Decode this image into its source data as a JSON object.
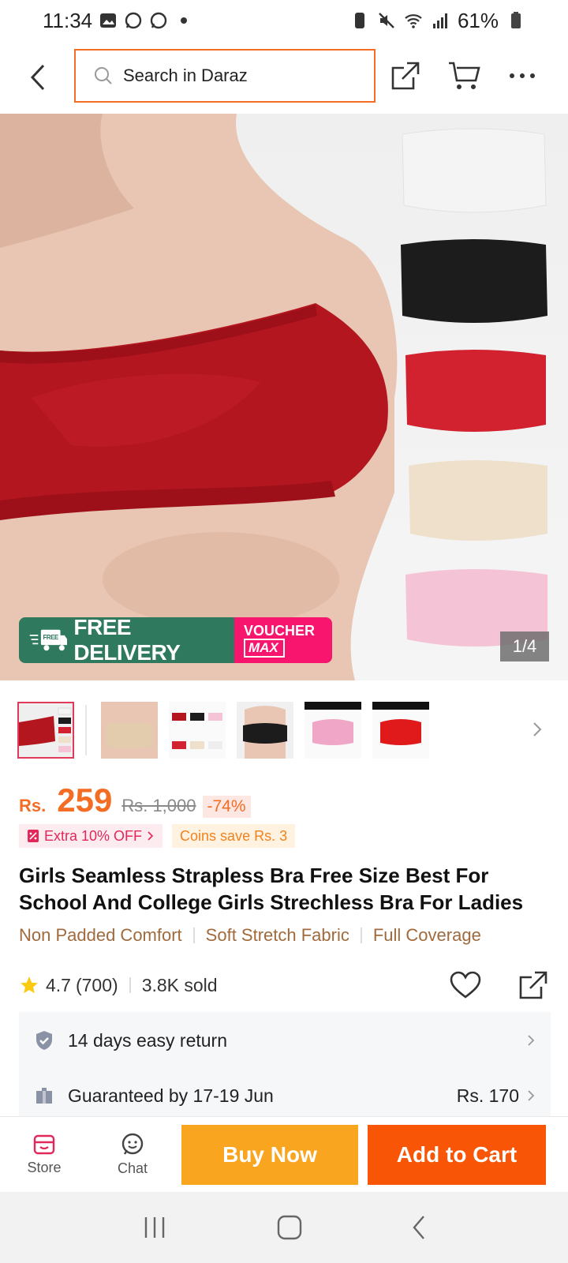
{
  "status_bar": {
    "time": "11:34",
    "battery": "61%"
  },
  "header": {
    "search_placeholder": "Search in Daraz"
  },
  "gallery": {
    "counter": "1/4",
    "promo_free_delivery": "FREE DELIVERY",
    "promo_free_badge": "FREE",
    "promo_voucher": "VOUCHER",
    "promo_max": "MAX",
    "swatch_colors": [
      "#f4f4f4",
      "#1c1c1c",
      "#d2212f",
      "#efe0cc",
      "#f5c3d6"
    ]
  },
  "product": {
    "currency": "Rs.",
    "price": "259",
    "old_price": "Rs. 1,000",
    "discount": "-74%",
    "extra_off": "Extra 10% OFF",
    "coins": "Coins save Rs. 3",
    "title": "Girls Seamless Strapless Bra Free Size Best For School And College Girls Strechless Bra For Ladies",
    "features": [
      "Non Padded Comfort",
      "Soft Stretch Fabric",
      "Full Coverage"
    ],
    "rating": "4.7",
    "rating_count": "(700)",
    "sold": "3.8K sold"
  },
  "services": {
    "return_text": "14 days easy return",
    "delivery_text": "Guaranteed by 17-19 Jun",
    "delivery_fee": "Rs. 170"
  },
  "actions": {
    "store": "Store",
    "chat": "Chat",
    "buy_now": "Buy Now",
    "add_to_cart": "Add to Cart"
  },
  "colors": {
    "accent": "#f85606",
    "buy_now": "#faa51f",
    "price": "#f36d24",
    "free_delivery": "#2f7a5e",
    "voucher": "#f7156e"
  }
}
